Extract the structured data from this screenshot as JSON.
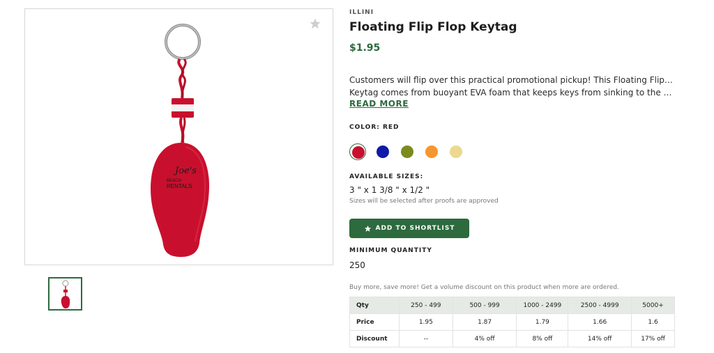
{
  "product": {
    "brand": "ILLINI",
    "title": "Floating Flip Flop Keytag",
    "price": "$1.95",
    "description_line1": "Customers will flip over this practical promotional pickup! This Floating Flip Flop",
    "description_line2": "Keytag comes from buoyant EVA foam that keeps keys from sinking to the bottom o...",
    "read_more": "READ MORE",
    "imprint_line1": "Joe's",
    "imprint_line2": "BEACH",
    "imprint_line3": "RENTALS"
  },
  "colors": {
    "label": "COLOR: RED",
    "swatches": [
      {
        "name": "red",
        "hex": "#c8102e",
        "selected": true
      },
      {
        "name": "blue",
        "hex": "#0f1aa8",
        "selected": false
      },
      {
        "name": "olive",
        "hex": "#7c8a1e",
        "selected": false
      },
      {
        "name": "orange",
        "hex": "#f6962e",
        "selected": false
      },
      {
        "name": "tan",
        "hex": "#ecd88f",
        "selected": false
      }
    ]
  },
  "sizes": {
    "label": "AVAILABLE SIZES:",
    "value": "3 \" x 1 3/8 \" x 1/2 \"",
    "note": "Sizes will be selected after proofs are approved"
  },
  "actions": {
    "add_to_shortlist": "ADD TO SHORTLIST"
  },
  "minimum_quantity": {
    "label": "MINIMUM QUANTITY",
    "value": "250"
  },
  "pricing": {
    "note": "Buy more, save more! Get a volume discount on this product when more are ordered.",
    "header": [
      "Qty",
      "250 - 499",
      "500 - 999",
      "1000 - 2499",
      "2500 - 4999",
      "5000+"
    ],
    "price_row": [
      "Price",
      "1.95",
      "1.87",
      "1.79",
      "1.66",
      "1.6"
    ],
    "discount_row": [
      "Discount",
      "--",
      "4% off",
      "8% off",
      "14% off",
      "17% off"
    ]
  },
  "theme": {
    "accent": "#2d6a3e",
    "product_red": "#c8102e"
  }
}
